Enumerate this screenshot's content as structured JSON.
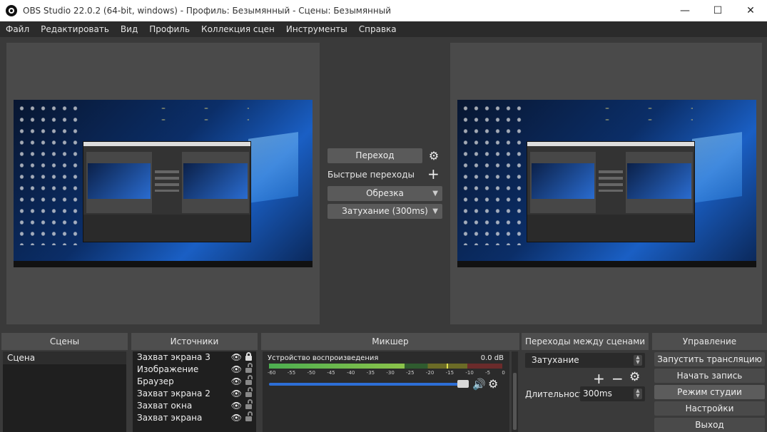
{
  "window": {
    "title": "OBS Studio 22.0.2 (64-bit, windows) - Профиль: Безымянный - Сцены: Безымянный",
    "minimize": "—",
    "maximize": "☐",
    "close": "✕"
  },
  "menu": {
    "items": [
      "Файл",
      "Редактировать",
      "Вид",
      "Профиль",
      "Коллекция сцен",
      "Инструменты",
      "Справка"
    ]
  },
  "center": {
    "transition_button": "Переход",
    "quick_transitions": "Быстрые переходы",
    "cut": "Обрезка",
    "fade": "Затухание (300ms)"
  },
  "scenes": {
    "title": "Сцены",
    "items": [
      "Сцена"
    ]
  },
  "sources": {
    "title": "Источники",
    "items": [
      {
        "name": "Захват экрана 3",
        "locked": true
      },
      {
        "name": "Изображение",
        "locked": false
      },
      {
        "name": "Браузер",
        "locked": false
      },
      {
        "name": "Захват экрана 2",
        "locked": false
      },
      {
        "name": "Захват окна",
        "locked": false
      },
      {
        "name": "Захват экрана",
        "locked": false
      }
    ]
  },
  "mixer": {
    "title": "Микшер",
    "device": "Устройство воспроизведения",
    "db": "0.0 dB",
    "ticks": [
      "-60",
      "-55",
      "-50",
      "-45",
      "-40",
      "-35",
      "-30",
      "-25",
      "-20",
      "-15",
      "-10",
      "-5",
      "0"
    ]
  },
  "transitions": {
    "title": "Переходы между сценами",
    "selected": "Затухание",
    "duration_label": "Длительность",
    "duration_value": "300ms"
  },
  "controls": {
    "title": "Управление",
    "start_stream": "Запустить трансляцию",
    "start_record": "Начать запись",
    "studio_mode": "Режим студии",
    "settings": "Настройки",
    "exit": "Выход"
  }
}
